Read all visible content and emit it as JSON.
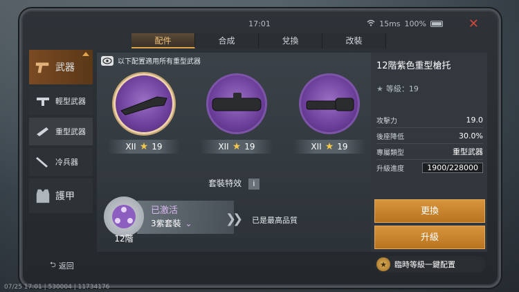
{
  "status": {
    "time": "17:01",
    "ping": "15ms",
    "battery": "100%"
  },
  "tabs": [
    {
      "label": "配件",
      "active": true
    },
    {
      "label": "合成"
    },
    {
      "label": "兌換"
    },
    {
      "label": "改裝"
    }
  ],
  "sidebar": {
    "items": [
      {
        "label": "武器",
        "icon": "pistol-icon"
      },
      {
        "label": "輕型武器",
        "icon": "smg-icon"
      },
      {
        "label": "重型武器",
        "icon": "heavy-weapon-icon"
      },
      {
        "label": "冷兵器",
        "icon": "knife-icon"
      },
      {
        "label": "護甲",
        "icon": "vest-icon"
      }
    ],
    "back_label": "返回"
  },
  "main": {
    "note": "以下配置適用所有重型武器",
    "parts": [
      {
        "tier": "XII",
        "level": "19",
        "icon": "stock-icon"
      },
      {
        "tier": "XII",
        "level": "19",
        "icon": "scope-icon"
      },
      {
        "tier": "XII",
        "level": "19",
        "icon": "muzzle-icon"
      }
    ],
    "set_effects_title": "套裝特效",
    "set": {
      "badge_label": "12階",
      "status": "已激活",
      "count": "3紫套裝",
      "max_quality": "已是最高品質"
    }
  },
  "detail": {
    "title": "12階紫色重型槍托",
    "level_label": "等級：19",
    "stats": [
      {
        "name": "攻擊力",
        "value": "19.0"
      },
      {
        "name": "後座降低",
        "value": "30.0%"
      },
      {
        "name": "專屬類型",
        "value": "重型武器"
      },
      {
        "name": "升級進度",
        "value": "1900/228000"
      }
    ],
    "replace_label": "更換",
    "upgrade_label": "升級",
    "quick_label": "臨時等級一鍵配置"
  },
  "footer": "07/25 17:01 | 530004 | 11734176",
  "colors": {
    "accent": "#e0a44a",
    "purple": "#6c3f9a",
    "button": "#c8842c"
  }
}
